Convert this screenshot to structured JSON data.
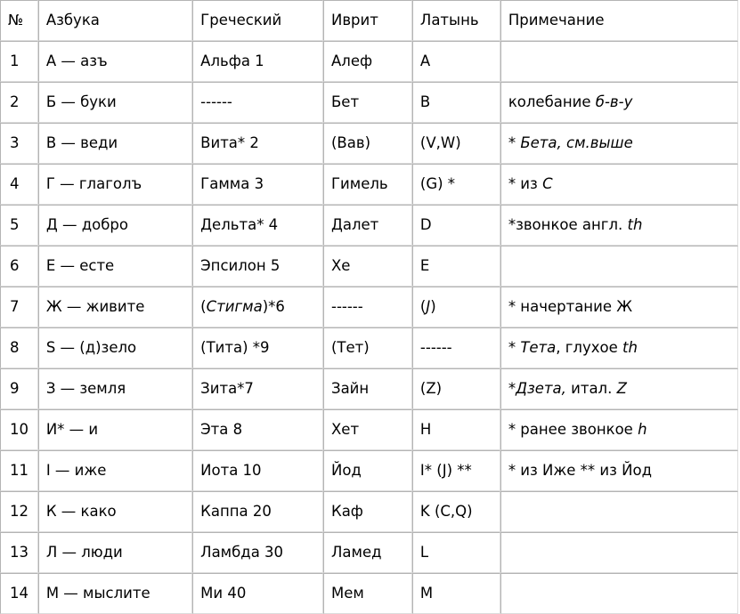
{
  "table": {
    "name": "cyrillic-alphabet-correspondence-table",
    "columns": [
      {
        "key": "num",
        "label": "№"
      },
      {
        "key": "azbuka",
        "label": "Азбука"
      },
      {
        "key": "greek",
        "label": "Греческий"
      },
      {
        "key": "hebrew",
        "label": "Иврит"
      },
      {
        "key": "latin",
        "label": "Латынь"
      },
      {
        "key": "note",
        "label": "Примечание"
      }
    ],
    "rows": [
      {
        "num": "1",
        "azbuka": "А — азъ",
        "greek": "Альфа 1",
        "hebrew": "Алеф",
        "latin": "A",
        "note": ""
      },
      {
        "num": "2",
        "azbuka": "Б — буки",
        "greek": "------",
        "hebrew": "Бет",
        "latin": "B",
        "note": "колебание б-в-у",
        "note_html": "колебание <i>б-в-у</i>"
      },
      {
        "num": "3",
        "azbuka": "В — веди",
        "greek": "Вита* 2",
        "hebrew": "(Вав)",
        "latin": "(V,W)",
        "note": "* Бета, см.выше",
        "note_html": "* <i>Бета, см.выше</i>"
      },
      {
        "num": "4",
        "azbuka": "Г — глаголъ",
        "greek": "Гамма 3",
        "hebrew": "Гимель",
        "latin": "(G) *",
        "note": "* из C",
        "note_html": "* из <i>C</i>"
      },
      {
        "num": "5",
        "azbuka": "Д — добро",
        "greek": "Дельта* 4",
        "hebrew": "Далет",
        "latin": "D",
        "note": "*звонкое англ. th",
        "note_html": "*звонкое англ. <i>th</i>"
      },
      {
        "num": "6",
        "azbuka": "Е — есте",
        "greek": "Эпсилон 5",
        "hebrew": "Хе",
        "latin": "E",
        "note": ""
      },
      {
        "num": "7",
        "azbuka": "Ж — живите",
        "greek": "(Стигма)*6",
        "greek_html": "(<i>Стигма</i>)*6",
        "hebrew": "------",
        "latin": "(J)",
        "latin_html": "(<i>J</i>)",
        "note": "* начертание Ж"
      },
      {
        "num": "8",
        "azbuka": "Ѕ — (д)зело",
        "greek": "(Тита) *9",
        "hebrew": "(Тет)",
        "latin": "------",
        "note": "* Тета, глухое th",
        "note_html": "* <i>Тета</i>, глухое <i>th</i>"
      },
      {
        "num": "9",
        "azbuka": "З — земля",
        "greek": "Зита*7",
        "hebrew": "Зайн",
        "latin": "(Z)",
        "note": "*Дзета, итал. Z",
        "note_html": "*<i>Дзета,</i> итал. <i>Z</i>"
      },
      {
        "num": "10",
        "azbuka": "И* — и",
        "greek": "Эта 8",
        "hebrew": "Хет",
        "latin": "H",
        "note": "* ранее звонкое h",
        "note_html": "* ранее звонкое <i>h</i>"
      },
      {
        "num": "11",
        "azbuka": "I — иже",
        "greek": "Иота 10",
        "hebrew": "Йод",
        "latin": "I* (J) **",
        "note": "* из Иже ** из Йод"
      },
      {
        "num": "12",
        "azbuka": "К — како",
        "greek": "Каппа 20",
        "hebrew": "Каф",
        "latin": "K (C,Q)",
        "note": ""
      },
      {
        "num": "13",
        "azbuka": "Л — люди",
        "greek": "Ламбда 30",
        "hebrew": "Ламед",
        "latin": "L",
        "note": ""
      },
      {
        "num": "14",
        "azbuka": "М — мыслите",
        "greek": "Ми 40",
        "hebrew": "Мем",
        "latin": "M",
        "note": ""
      }
    ]
  },
  "colors": {
    "background": "#ffffff",
    "text": "#000000",
    "border": "#c8c8c8"
  }
}
